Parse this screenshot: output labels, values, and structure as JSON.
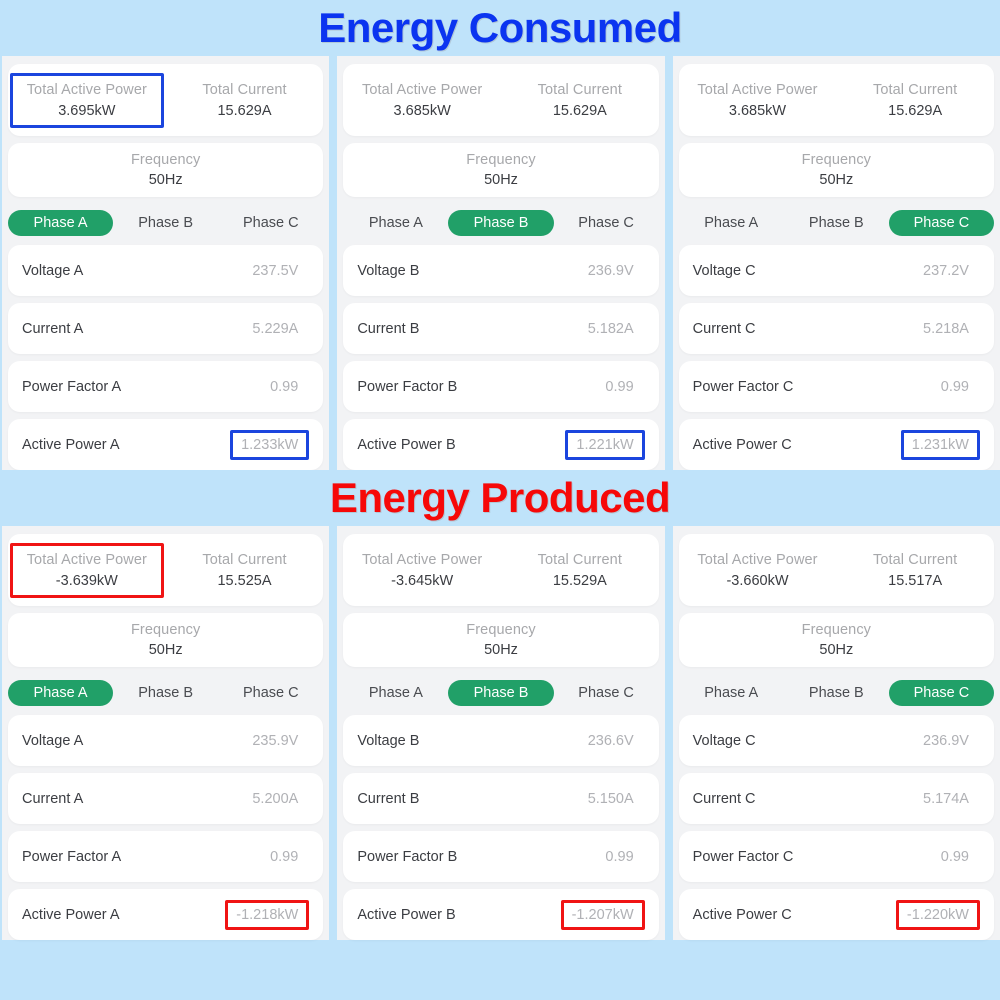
{
  "sections": [
    {
      "id": "energy-consumed",
      "title": "Energy Consumed",
      "title_color": "#0b34f0",
      "panels": [
        {
          "id": "panel-phase-a",
          "summary": {
            "total_active_power": {
              "label": "Total Active Power",
              "value": "3.695kW",
              "highlight": "blue"
            },
            "total_current": {
              "label": "Total Current",
              "value": "15.629A",
              "highlight": "none"
            }
          },
          "frequency": {
            "label": "Frequency",
            "value": "50Hz"
          },
          "tabs": [
            {
              "label": "Phase A",
              "active": true
            },
            {
              "label": "Phase B",
              "active": false
            },
            {
              "label": "Phase C",
              "active": false
            }
          ],
          "rows": [
            {
              "label": "Voltage A",
              "value": "237.5V",
              "highlight": "none"
            },
            {
              "label": "Current A",
              "value": "5.229A",
              "highlight": "none"
            },
            {
              "label": "Power Factor A",
              "value": "0.99",
              "highlight": "none"
            },
            {
              "label": "Active Power A",
              "value": "1.233kW",
              "highlight": "blue"
            }
          ]
        },
        {
          "id": "panel-phase-b",
          "summary": {
            "total_active_power": {
              "label": "Total Active Power",
              "value": "3.685kW",
              "highlight": "none"
            },
            "total_current": {
              "label": "Total Current",
              "value": "15.629A",
              "highlight": "none"
            }
          },
          "frequency": {
            "label": "Frequency",
            "value": "50Hz"
          },
          "tabs": [
            {
              "label": "Phase A",
              "active": false
            },
            {
              "label": "Phase B",
              "active": true
            },
            {
              "label": "Phase C",
              "active": false
            }
          ],
          "rows": [
            {
              "label": "Voltage B",
              "value": "236.9V",
              "highlight": "none"
            },
            {
              "label": "Current B",
              "value": "5.182A",
              "highlight": "none"
            },
            {
              "label": "Power Factor B",
              "value": "0.99",
              "highlight": "none"
            },
            {
              "label": "Active Power B",
              "value": "1.221kW",
              "highlight": "blue"
            }
          ]
        },
        {
          "id": "panel-phase-c",
          "summary": {
            "total_active_power": {
              "label": "Total Active Power",
              "value": "3.685kW",
              "highlight": "none"
            },
            "total_current": {
              "label": "Total Current",
              "value": "15.629A",
              "highlight": "none"
            }
          },
          "frequency": {
            "label": "Frequency",
            "value": "50Hz"
          },
          "tabs": [
            {
              "label": "Phase A",
              "active": false
            },
            {
              "label": "Phase B",
              "active": false
            },
            {
              "label": "Phase C",
              "active": true
            }
          ],
          "rows": [
            {
              "label": "Voltage C",
              "value": "237.2V",
              "highlight": "none"
            },
            {
              "label": "Current C",
              "value": "5.218A",
              "highlight": "none"
            },
            {
              "label": "Power Factor C",
              "value": "0.99",
              "highlight": "none"
            },
            {
              "label": "Active Power C",
              "value": "1.231kW",
              "highlight": "blue"
            }
          ]
        }
      ]
    },
    {
      "id": "energy-produced",
      "title": "Energy Produced",
      "title_color": "#f60808",
      "panels": [
        {
          "id": "panel-phase-a",
          "summary": {
            "total_active_power": {
              "label": "Total Active Power",
              "value": "-3.639kW",
              "highlight": "red"
            },
            "total_current": {
              "label": "Total Current",
              "value": "15.525A",
              "highlight": "none"
            }
          },
          "frequency": {
            "label": "Frequency",
            "value": "50Hz"
          },
          "tabs": [
            {
              "label": "Phase A",
              "active": true
            },
            {
              "label": "Phase B",
              "active": false
            },
            {
              "label": "Phase C",
              "active": false
            }
          ],
          "rows": [
            {
              "label": "Voltage A",
              "value": "235.9V",
              "highlight": "none"
            },
            {
              "label": "Current A",
              "value": "5.200A",
              "highlight": "none"
            },
            {
              "label": "Power Factor A",
              "value": "0.99",
              "highlight": "none"
            },
            {
              "label": "Active Power A",
              "value": "-1.218kW",
              "highlight": "red"
            }
          ]
        },
        {
          "id": "panel-phase-b",
          "summary": {
            "total_active_power": {
              "label": "Total Active Power",
              "value": "-3.645kW",
              "highlight": "none"
            },
            "total_current": {
              "label": "Total Current",
              "value": "15.529A",
              "highlight": "none"
            }
          },
          "frequency": {
            "label": "Frequency",
            "value": "50Hz"
          },
          "tabs": [
            {
              "label": "Phase A",
              "active": false
            },
            {
              "label": "Phase B",
              "active": true
            },
            {
              "label": "Phase C",
              "active": false
            }
          ],
          "rows": [
            {
              "label": "Voltage B",
              "value": "236.6V",
              "highlight": "none"
            },
            {
              "label": "Current B",
              "value": "5.150A",
              "highlight": "none"
            },
            {
              "label": "Power Factor B",
              "value": "0.99",
              "highlight": "none"
            },
            {
              "label": "Active Power B",
              "value": "-1.207kW",
              "highlight": "red"
            }
          ]
        },
        {
          "id": "panel-phase-c",
          "summary": {
            "total_active_power": {
              "label": "Total Active Power",
              "value": "-3.660kW",
              "highlight": "none"
            },
            "total_current": {
              "label": "Total Current",
              "value": "15.517A",
              "highlight": "none"
            }
          },
          "frequency": {
            "label": "Frequency",
            "value": "50Hz"
          },
          "tabs": [
            {
              "label": "Phase A",
              "active": false
            },
            {
              "label": "Phase B",
              "active": false
            },
            {
              "label": "Phase C",
              "active": true
            }
          ],
          "rows": [
            {
              "label": "Voltage C",
              "value": "236.9V",
              "highlight": "none"
            },
            {
              "label": "Current C",
              "value": "5.174A",
              "highlight": "none"
            },
            {
              "label": "Power Factor C",
              "value": "0.99",
              "highlight": "none"
            },
            {
              "label": "Active Power C",
              "value": "-1.220kW",
              "highlight": "red"
            }
          ]
        }
      ]
    }
  ],
  "colors": {
    "background": "#bfe3fa",
    "panel_bg": "#f2f3f5",
    "card_bg": "#ffffff",
    "accent_green": "#21a068",
    "highlight_blue": "#1b45de",
    "highlight_red": "#f01414",
    "label_gray": "#a7a8ab",
    "value_gray": "#b0b1b5",
    "text_dark": "#3b3d42"
  }
}
